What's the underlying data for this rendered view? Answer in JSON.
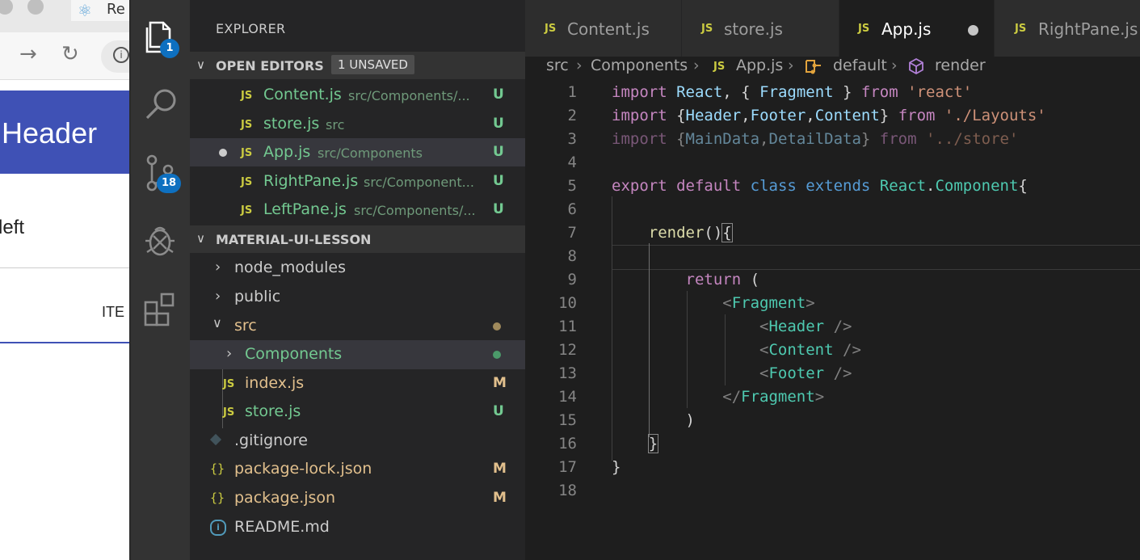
{
  "browser": {
    "tab_title": "Re",
    "appbar_title": "Header",
    "left_text": "left",
    "item_text": "ITE",
    "colors": {
      "appbar": "#3f51b5"
    }
  },
  "activity_bar": {
    "items": [
      {
        "icon": "files-icon",
        "badge": "1"
      },
      {
        "icon": "search-icon"
      },
      {
        "icon": "source-control-icon",
        "badge": "18"
      },
      {
        "icon": "debug-icon"
      },
      {
        "icon": "extensions-icon"
      }
    ]
  },
  "sidebar": {
    "title": "EXPLORER",
    "open_editors": {
      "label": "OPEN EDITORS",
      "badge": "1 UNSAVED",
      "files": [
        {
          "icon": "JS",
          "name": "Content.js",
          "path": "src/Components/...",
          "status": "U"
        },
        {
          "icon": "JS",
          "name": "store.js",
          "path": "src",
          "status": "U"
        },
        {
          "icon": "JS",
          "name": "App.js",
          "path": "src/Components",
          "status": "U"
        },
        {
          "icon": "JS",
          "name": "RightPane.js",
          "path": "src/Component...",
          "status": "U"
        },
        {
          "icon": "JS",
          "name": "LeftPane.js",
          "path": "src/Components/...",
          "status": "U"
        }
      ]
    },
    "project": {
      "label": "MATERIAL-UI-LESSON",
      "items": [
        {
          "name": "node_modules"
        },
        {
          "name": "public"
        },
        {
          "name": "src"
        },
        {
          "name": "Components"
        },
        {
          "icon": "JS",
          "name": "index.js",
          "status": "M"
        },
        {
          "icon": "JS",
          "name": "store.js",
          "status": "U"
        },
        {
          "icon": "git-icon",
          "name": ".gitignore"
        },
        {
          "icon": "{}",
          "name": "package-lock.json",
          "status": "M"
        },
        {
          "icon": "{}",
          "name": "package.json",
          "status": "M"
        },
        {
          "icon": "info-icon",
          "name": "README.md"
        }
      ]
    }
  },
  "editor": {
    "tabs": [
      {
        "icon": "JS",
        "name": "Content.js"
      },
      {
        "icon": "JS",
        "name": "store.js"
      },
      {
        "icon": "JS",
        "name": "App.js"
      },
      {
        "icon": "JS",
        "name": "RightPane.js"
      }
    ],
    "breadcrumb": [
      "src",
      "Components",
      "App.js",
      "default",
      "render"
    ],
    "line_numbers": [
      "1",
      "2",
      "3",
      "4",
      "5",
      "6",
      "7",
      "8",
      "9",
      "10",
      "11",
      "12",
      "13",
      "14",
      "15",
      "16",
      "17",
      "18"
    ],
    "colors": {
      "keyword": "#c586c0",
      "storage": "#569cd6",
      "type": "#4ec9b0",
      "variable": "#9cdcfe",
      "string": "#ce9178",
      "function": "#dcdcaa",
      "modified": "#e2c08d",
      "untracked": "#73c991",
      "js_icon": "#cbcb41"
    }
  }
}
